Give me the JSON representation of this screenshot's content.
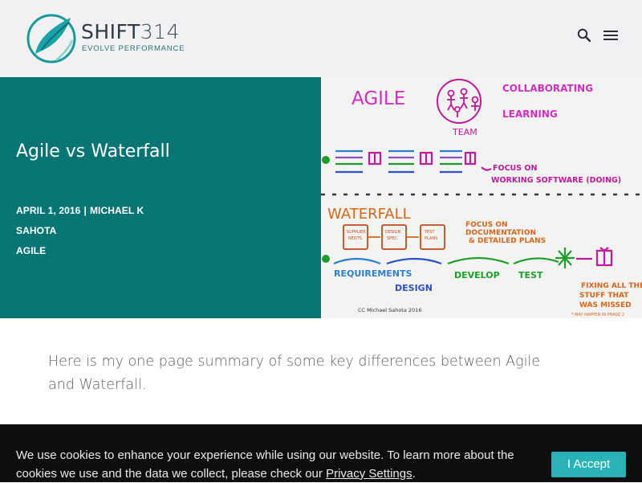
{
  "header": {
    "logo_name_bold": "SHIFT",
    "logo_name_light": "314",
    "logo_tagline": "EVOLVE PERFORMANCE",
    "search_icon": "search-icon",
    "menu_icon": "hamburger-menu-icon"
  },
  "post": {
    "title": "Agile vs Waterfall",
    "date": "APRIL 1, 2016",
    "separator": "|",
    "author": "MICHAEL K SAHOTA",
    "category": "AGILE"
  },
  "hero_image": {
    "labels": {
      "agile": "AGILE",
      "collaborating": "COLLABORATING",
      "learning": "LEARNING",
      "team": "TEAM",
      "focus_working_1": "FOCUS ON",
      "focus_working_2": "WORKING SOFTWARE (DOING)",
      "waterfall": "WATERFALL",
      "doc1a": "SUPPLIER",
      "doc1b": "REQTS.",
      "doc2a": "DESIGN",
      "doc2b": "SPEC.",
      "doc3a": "TEST",
      "doc3b": "PLANS",
      "focus_doc_1": "FOCUS ON",
      "focus_doc_2": "DOCUMENTATION",
      "focus_doc_3": "& DETAILED PLANS",
      "requirements": "REQUIREMENTS",
      "design": "DESIGN",
      "develop": "DEVELOP",
      "test": "TEST",
      "fixing_1": "FIXING ALL THE",
      "fixing_2": "STUFF THAT",
      "fixing_3": "WAS MISSED",
      "fixing_note": "* MAY HAPPEN IN PHASE 2",
      "credit": "CC Michael Sahota 2016"
    }
  },
  "content": {
    "intro": "Here is my one page summary of some key differences between Agile and Waterfall."
  },
  "cookie": {
    "text": "We use cookies to enhance your experience while using our website. To learn more about the cookies we use and the data we collect, please check our",
    "link": "Privacy Settings",
    "suffix": ".",
    "accept_label": "I Accept"
  },
  "colors": {
    "teal": "#087575",
    "accept": "#2ab3b6",
    "header_bg": "#f1f1f4",
    "cookie_bg": "#0e0e10"
  }
}
